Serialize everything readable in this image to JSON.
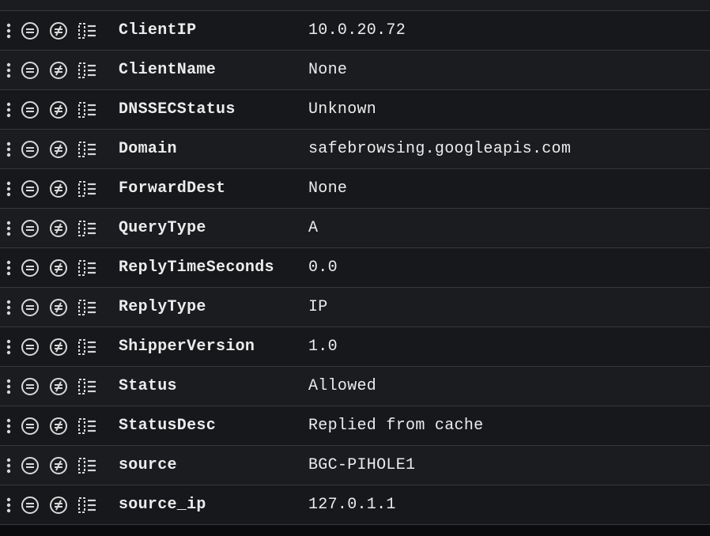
{
  "fields": [
    {
      "name": "ClientIP",
      "value": "10.0.20.72"
    },
    {
      "name": "ClientName",
      "value": "None"
    },
    {
      "name": "DNSSECStatus",
      "value": "Unknown"
    },
    {
      "name": "Domain",
      "value": "safebrowsing.googleapis.com"
    },
    {
      "name": "ForwardDest",
      "value": "None"
    },
    {
      "name": "QueryType",
      "value": "A"
    },
    {
      "name": "ReplyTimeSeconds",
      "value": "0.0"
    },
    {
      "name": "ReplyType",
      "value": "IP"
    },
    {
      "name": "ShipperVersion",
      "value": "1.0"
    },
    {
      "name": "Status",
      "value": "Allowed"
    },
    {
      "name": "StatusDesc",
      "value": "Replied from cache"
    },
    {
      "name": "source",
      "value": "BGC-PIHOLE1"
    },
    {
      "name": "source_ip",
      "value": "127.0.1.1"
    }
  ]
}
